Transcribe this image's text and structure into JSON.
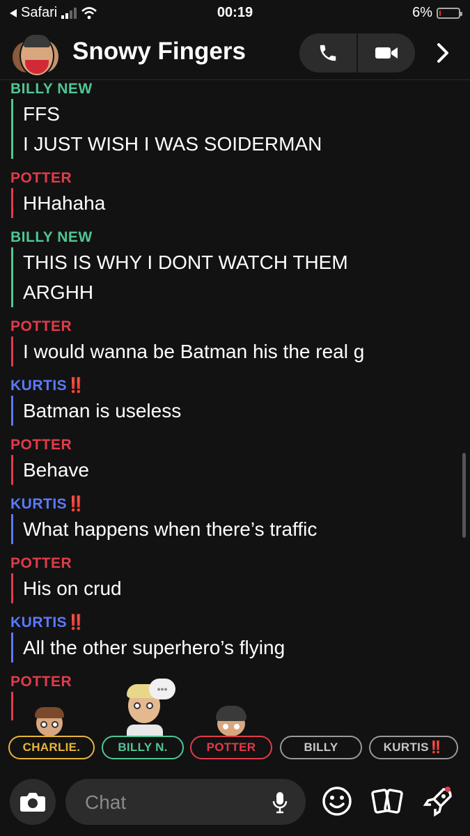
{
  "status_bar": {
    "back_app": "Safari",
    "time": "00:19",
    "battery_percent": "6%",
    "battery_level": 0.06
  },
  "header": {
    "title": "Snowy Fingers"
  },
  "messages": [
    {
      "sender": "BILLY NEW",
      "color": "billy",
      "lines": [
        "FFS",
        "I JUST WISH I WAS SOIDERMAN"
      ]
    },
    {
      "sender": "POTTER",
      "color": "potter",
      "lines": [
        "HHahaha"
      ]
    },
    {
      "sender": "BILLY NEW",
      "color": "billy",
      "lines": [
        "THIS IS WHY I DONT WATCH THEM",
        "ARGHH"
      ]
    },
    {
      "sender": "POTTER",
      "color": "potter",
      "lines": [
        "I would wanna be Batman his the real g"
      ]
    },
    {
      "sender": "KURTIS",
      "sender_suffix": "‼️",
      "color": "kurtis",
      "lines": [
        "Batman is useless"
      ]
    },
    {
      "sender": "POTTER",
      "color": "potter",
      "lines": [
        "Behave"
      ]
    },
    {
      "sender": "KURTIS",
      "sender_suffix": "‼️",
      "color": "kurtis",
      "lines": [
        "What happens when there’s traffic"
      ]
    },
    {
      "sender": "POTTER",
      "color": "potter",
      "lines": [
        "His on crud"
      ]
    },
    {
      "sender": "KURTIS",
      "sender_suffix": "‼️",
      "color": "kurtis",
      "lines": [
        "All the other superhero’s flying"
      ]
    },
    {
      "sender": "POTTER",
      "color": "potter",
      "lines": [
        ""
      ]
    }
  ],
  "presence_chips": [
    {
      "label": "CHARLIE.",
      "color": "#e8b53a"
    },
    {
      "label": "BILLY N.",
      "color": "#4fc794"
    },
    {
      "label": "POTTER",
      "color": "#e23b4a"
    },
    {
      "label": "BILLY",
      "color": "#9a9a9a"
    },
    {
      "label": "KURTIS",
      "suffix": "‼️",
      "color": "#9a9a9a"
    }
  ],
  "typing_indicator": "•••",
  "composer": {
    "placeholder": "Chat"
  },
  "colors": {
    "billy": "#4fc794",
    "potter": "#e23b4a",
    "kurtis": "#5a7aff",
    "background": "#121212"
  },
  "icons": [
    "back-arrow-icon",
    "signal-icon",
    "wifi-icon",
    "battery-icon",
    "phone-icon",
    "video-camera-icon",
    "chevron-right-icon",
    "camera-icon",
    "microphone-icon",
    "smiley-icon",
    "cards-icon",
    "rocket-icon"
  ]
}
